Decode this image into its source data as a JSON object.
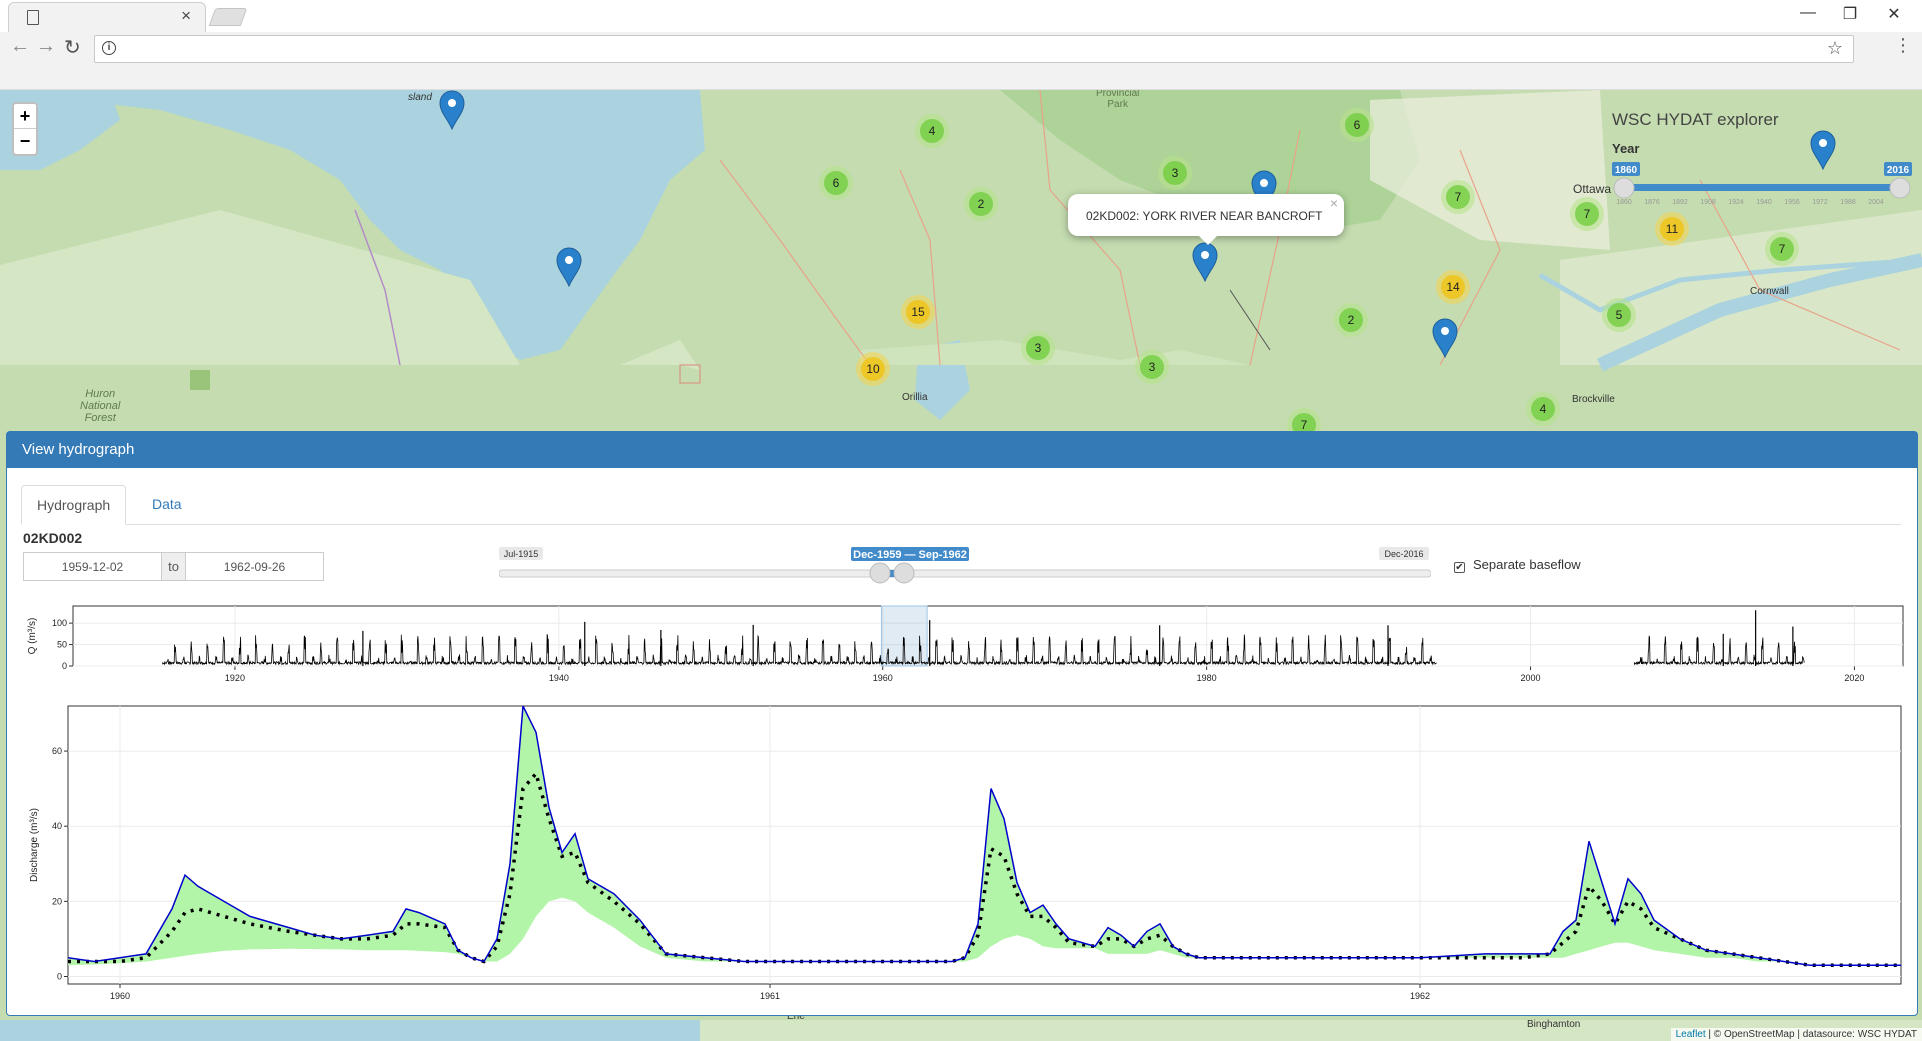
{
  "browser": {
    "close_tab": "×",
    "minimize": "—",
    "restore": "❐",
    "close": "✕"
  },
  "map": {
    "zoom_in": "+",
    "zoom_out": "−",
    "title": "WSC HYDAT explorer",
    "year_label": "Year",
    "year_min": "1860",
    "year_max": "2016",
    "year_ticks": [
      "1860",
      "1876",
      "1892",
      "1908",
      "1924",
      "1940",
      "1956",
      "1972",
      "1988",
      "2004"
    ],
    "popup_text": "02KD002: YORK RIVER NEAR BANCROFT",
    "place_labels": [
      "Provincial",
      "Park",
      "Huron",
      "National",
      "Forest",
      "Orillia",
      "Ottawa",
      "Cornwall",
      "Brockville",
      "Binghamton",
      "Erie",
      "sland"
    ],
    "clusters": [
      {
        "count": "4",
        "color": "green"
      },
      {
        "count": "6",
        "color": "green"
      },
      {
        "count": "6",
        "color": "green"
      },
      {
        "count": "2",
        "color": "green"
      },
      {
        "count": "3",
        "color": "green"
      },
      {
        "count": "7",
        "color": "green"
      },
      {
        "count": "7",
        "color": "green"
      },
      {
        "count": "11",
        "color": "yellow"
      },
      {
        "count": "7",
        "color": "green"
      },
      {
        "count": "14",
        "color": "yellow"
      },
      {
        "count": "15",
        "color": "yellow"
      },
      {
        "count": "10",
        "color": "yellow"
      },
      {
        "count": "3",
        "color": "green"
      },
      {
        "count": "3",
        "color": "green"
      },
      {
        "count": "2",
        "color": "green"
      },
      {
        "count": "5",
        "color": "green"
      },
      {
        "count": "4",
        "color": "green"
      },
      {
        "count": "7",
        "color": "green"
      }
    ],
    "attribution_link": "Leaflet",
    "attribution_text": " | © OpenStreetMap | datasource: WSC HYDAT"
  },
  "panel": {
    "header": "View hydrograph",
    "tabs": [
      "Hydrograph",
      "Data"
    ],
    "station_id": "02KD002",
    "date_from": "1959-12-02",
    "date_to_label": "to",
    "date_to": "1962-09-26",
    "range_min": "Jul-1915",
    "range_max": "Dec-2016",
    "range_selected": "Dec-1959 — Sep-1962",
    "checkbox_label": "Separate baseflow",
    "checkbox_checked": true
  },
  "colors": {
    "brand": "#337ab7",
    "flow": "#0000cc",
    "baseflow_fill": "#b3f5a8"
  },
  "chart_data": [
    {
      "type": "line",
      "title": "",
      "xlabel": "",
      "ylabel": "Q (m³/s)",
      "xlim": [
        1910,
        2023
      ],
      "ylim": [
        0,
        140
      ],
      "xticks": [
        "1920",
        "1940",
        "1960",
        "1980",
        "2000",
        "2020"
      ],
      "yticks": [
        "0",
        "50",
        "100"
      ],
      "selected_window": [
        1959.92,
        1962.74
      ],
      "data_segments": [
        [
          1915.5,
          1994.2
        ],
        [
          2006.4,
          2016.9
        ]
      ],
      "notable_peaks": [
        {
          "x": 1927.9,
          "y": 82
        },
        {
          "x": 1941.6,
          "y": 103
        },
        {
          "x": 1946.3,
          "y": 84
        },
        {
          "x": 1952.0,
          "y": 96
        },
        {
          "x": 1962.9,
          "y": 107
        },
        {
          "x": 1977.1,
          "y": 95
        },
        {
          "x": 1991.2,
          "y": 95
        },
        {
          "x": 2011.9,
          "y": 75
        },
        {
          "x": 2013.9,
          "y": 130
        },
        {
          "x": 2016.2,
          "y": 92
        }
      ]
    },
    {
      "type": "area",
      "title": "",
      "xlabel": "",
      "ylabel": "Discharge (m³/s)",
      "xlim": [
        1959.92,
        1962.74
      ],
      "ylim": [
        -2,
        72
      ],
      "xticks": [
        "1960",
        "1961",
        "1962"
      ],
      "yticks": [
        "0",
        "20",
        "40",
        "60"
      ],
      "x": [
        1959.92,
        1959.96,
        1960.0,
        1960.04,
        1960.08,
        1960.1,
        1960.12,
        1960.16,
        1960.2,
        1960.26,
        1960.3,
        1960.34,
        1960.38,
        1960.42,
        1960.44,
        1960.46,
        1960.5,
        1960.52,
        1960.54,
        1960.56,
        1960.58,
        1960.6,
        1960.62,
        1960.64,
        1960.66,
        1960.68,
        1960.7,
        1960.72,
        1960.76,
        1960.8,
        1960.84,
        1960.9,
        1960.96,
        1961.05,
        1961.15,
        1961.22,
        1961.28,
        1961.3,
        1961.32,
        1961.34,
        1961.36,
        1961.38,
        1961.4,
        1961.42,
        1961.44,
        1961.46,
        1961.5,
        1961.52,
        1961.54,
        1961.56,
        1961.58,
        1961.6,
        1961.62,
        1961.64,
        1961.66,
        1961.72,
        1961.8,
        1961.9,
        1962.0,
        1962.1,
        1962.16,
        1962.2,
        1962.22,
        1962.24,
        1962.26,
        1962.28,
        1962.3,
        1962.32,
        1962.34,
        1962.36,
        1962.4,
        1962.44,
        1962.48,
        1962.52,
        1962.56,
        1962.6,
        1962.66,
        1962.7,
        1962.74
      ],
      "series": [
        {
          "name": "",
          "values": [
            5,
            4,
            5,
            6,
            18,
            27,
            24,
            20,
            16,
            13,
            11,
            10,
            11,
            12,
            18,
            17,
            14,
            7,
            5,
            4,
            10,
            30,
            72,
            65,
            45,
            33,
            38,
            26,
            22,
            15,
            6,
            5,
            4,
            4,
            4,
            4,
            4,
            5,
            14,
            50,
            42,
            25,
            17,
            19,
            14,
            10,
            8,
            13,
            11,
            8,
            12,
            14,
            8,
            6,
            5,
            5,
            5,
            5,
            5,
            6,
            6,
            6,
            12,
            15,
            36,
            25,
            14,
            26,
            22,
            15,
            10,
            7,
            6,
            5,
            4,
            3,
            3,
            3,
            3
          ]
        },
        {
          "name": "",
          "values": [
            4,
            4,
            4,
            5,
            12,
            17,
            18,
            16,
            14,
            12,
            11,
            10,
            10,
            11,
            14,
            14,
            13,
            7,
            5,
            4,
            8,
            22,
            50,
            54,
            42,
            32,
            33,
            25,
            20,
            14,
            6,
            5,
            4,
            4,
            4,
            4,
            4,
            5,
            11,
            34,
            32,
            22,
            16,
            16,
            13,
            9,
            8,
            10,
            10,
            8,
            10,
            11,
            8,
            6,
            5,
            5,
            5,
            5,
            5,
            5,
            5,
            6,
            9,
            12,
            24,
            20,
            14,
            20,
            18,
            13,
            10,
            7,
            6,
            5,
            4,
            3,
            3,
            3,
            3
          ]
        },
        {
          "name": "",
          "values": [
            3,
            3.2,
            3.5,
            4,
            5,
            5.5,
            6,
            6.8,
            7.2,
            7.4,
            7.3,
            7.2,
            7,
            7,
            7,
            6.8,
            6.5,
            6,
            5,
            4,
            4,
            6,
            10,
            16,
            20,
            21,
            20,
            17,
            13,
            8,
            5,
            4,
            4,
            4,
            4,
            4,
            4,
            4,
            5,
            8,
            10,
            11,
            10,
            8,
            7.5,
            7.5,
            7.5,
            6,
            6,
            6,
            6,
            7,
            6,
            5,
            5,
            5,
            5,
            5,
            5,
            5,
            5,
            5,
            5,
            6,
            7,
            8,
            9,
            9,
            8,
            7,
            6,
            5,
            5,
            4,
            4,
            3,
            3,
            3,
            3
          ]
        }
      ]
    }
  ]
}
